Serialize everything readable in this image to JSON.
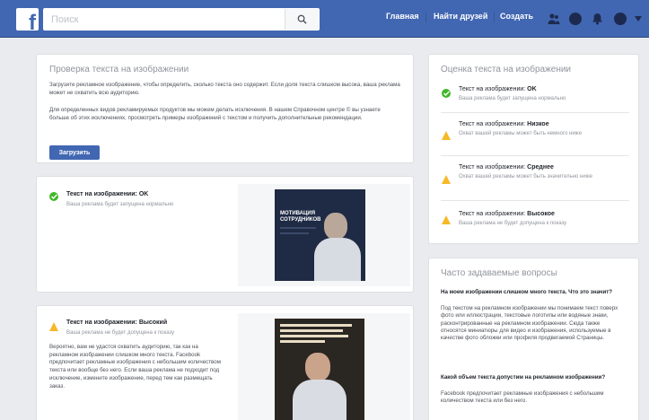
{
  "header": {
    "logo_letter": "f",
    "search_placeholder": "Поиск",
    "nav": [
      "Главная",
      "Найти друзей",
      "Создать"
    ],
    "icons": [
      "friends-icon",
      "messenger-icon",
      "notifications-icon",
      "help-icon",
      "menu-arrow-icon"
    ]
  },
  "checker": {
    "title": "Проверка текста на изображении",
    "para1": "Загрузите рекламное изображение, чтобы определить, сколько текста оно содержит. Если доля текста слишком высока, ваша реклама может не охватить всю аудиторию.",
    "para2": "Для определенных видов рекламируемых продуктов мы можем делать исключения. В нашем Справочном центре © вы узнаете больше об этих исключениях, просмотреть примеры изображений с текстом и получить дополнительные рекомендации.",
    "upload_label": "Загрузить"
  },
  "result_ok": {
    "title": "Текст на изображении: OK",
    "sub": "Ваша реклама будет запущена нормально",
    "image_caption": "МОТИВАЦИЯ СОТРУДНИКОВ"
  },
  "result_high": {
    "title": "Текст на изображении: Высокий",
    "sub": "Ваша реклама не будет допущена к показу",
    "body": "Вероятно, вам не удастся охватить аудиторию, так как на рекламном изображении слишком много текста. Facebook предпочитает рекламные изображения с небольшим количеством текста или вообще без него. Если ваша реклама не подходит под исключение, измените изображение, перед тем как размещать заказ."
  },
  "ratings": {
    "title": "Оценка текста на изображении",
    "items": [
      {
        "label": "Текст на изображении:",
        "level": "OK",
        "desc": "Ваша реклама будет запущена нормально",
        "icon": "ok"
      },
      {
        "label": "Текст на изображении:",
        "level": "Низкое",
        "desc": "Охват вашей рекламы может быть немного ниже",
        "icon": "warn"
      },
      {
        "label": "Текст на изображении:",
        "level": "Среднее",
        "desc": "Охват вашей рекламы может быть значительно ниже",
        "icon": "warn"
      },
      {
        "label": "Текст на изображении:",
        "level": "Высокое",
        "desc": "Ваша реклама не будет допущена к показу",
        "icon": "warn"
      }
    ]
  },
  "faq": {
    "title": "Часто задаваемые вопросы",
    "q1": "На моем изображении слишком много текста. Что это значит?",
    "a1": "Под текстом на рекламном изображении мы понимаем текст поверх фото или иллюстрации, текстовые логотипы или водяные знаки, расконтрированные на рекламном изображении. Сюда также относятся миниатюры для видео и изображения, используемые в качестве фото обложки или профиля продвигаемой Страницы.",
    "q2": "Какой объем текста допустим на рекламном изображении?",
    "a2": "Facebook предпочитает рекламные изображения с небольшим количеством текста или без него."
  },
  "colors": {
    "brand": "#4267b2",
    "ok": "#42b72a",
    "warning": "#f7b928",
    "background": "#e9ebee"
  }
}
